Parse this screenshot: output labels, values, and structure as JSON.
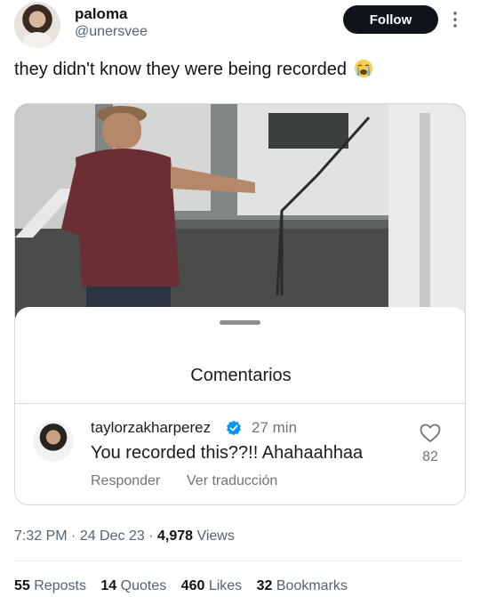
{
  "author": {
    "name": "paloma",
    "handle": "@unersvee"
  },
  "follow_label": "Follow",
  "tweet": {
    "text": "they didn't know they were being recorded",
    "emoji": "loudly-crying-face"
  },
  "comments_panel": {
    "title": "Comentarios",
    "comment": {
      "username": "taylorzakharperez",
      "verified": true,
      "time": "27 min",
      "text": "You recorded this??!! Ahahaahhaa",
      "likes": "82",
      "reply_label": "Responder",
      "translate_label": "Ver traducción"
    }
  },
  "meta": {
    "time": "7:32 PM",
    "sep1": " · ",
    "date": "24 Dec 23",
    "sep2": " · ",
    "views_count": "4,978",
    "views_label": " Views"
  },
  "stats": {
    "reposts_count": "55",
    "reposts_label": " Reposts",
    "quotes_count": "14",
    "quotes_label": " Quotes",
    "likes_count": "460",
    "likes_label": " Likes",
    "bookmarks_count": "32",
    "bookmarks_label": " Bookmarks"
  },
  "colors": {
    "text_primary": "#0f1419",
    "text_secondary": "#536471",
    "follow_bg": "#0f1419",
    "verified_blue": "#0095f6"
  }
}
